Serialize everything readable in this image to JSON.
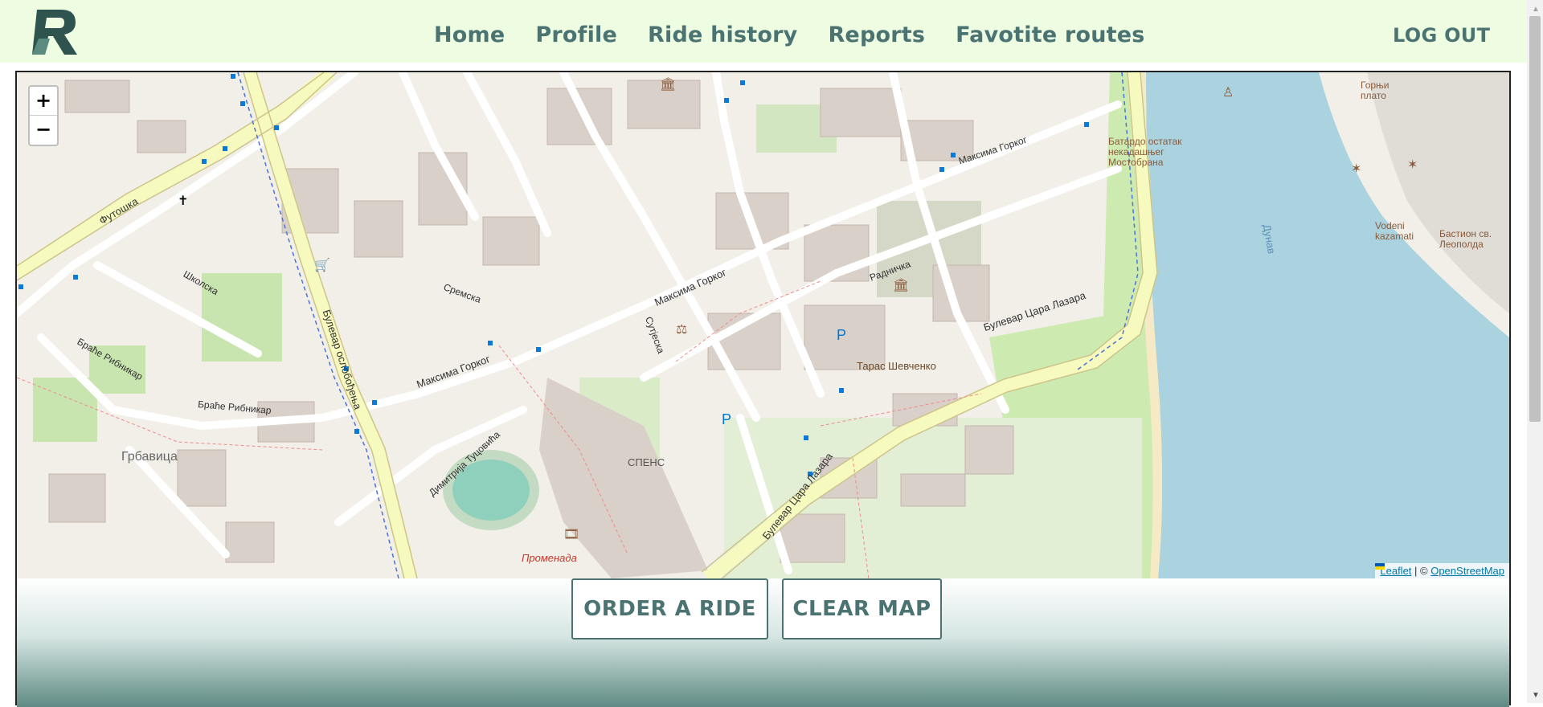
{
  "header": {
    "logo_alt": "R",
    "nav": [
      {
        "label": "Home"
      },
      {
        "label": "Profile"
      },
      {
        "label": "Ride history"
      },
      {
        "label": "Reports"
      },
      {
        "label": "Favotite routes"
      }
    ],
    "logout_label": "LOG OUT"
  },
  "map": {
    "zoom_in": "+",
    "zoom_out": "−",
    "attribution": {
      "leaflet": "Leaflet",
      "separator": " | © ",
      "osm": "OpenStreetMap"
    },
    "labels": {
      "futoshka": "Футошка",
      "skolska": "Школска",
      "bulevar_oslobodjenja": "Булевар ослобођења",
      "maksima_gorkog": "Максима Горког",
      "maksima_gorkog_2": "Максима Горког",
      "maksima_gorkog_3": "Максима Горког",
      "bulevar_cara_lazara": "Булевар Цара Лазара",
      "bulevar_cara_lazara_2": "Булевар Цара Лазара",
      "grbavica": "Грбавица",
      "spens": "СПЕНС",
      "promenada": "Променада",
      "taras": "Тарас Шевченко",
      "dunav": "Дунав",
      "batardo": "Батардо остатак некадашњег Мостобрана",
      "vodeni": "Vodeni kazamati",
      "bastion": "Бастион св. Леополда",
      "gornji_plato": "Горњи плато",
      "sremska": "Сремска",
      "radnichka": "Радничка",
      "brace_ribnikar": "Браће Рибникар",
      "brace_ribnikar_2": "Браће Рибникар",
      "sutjeska": "Сутјеска",
      "dimitrija": "Димитрија Туцовића",
      "p1": "P",
      "p2": "P"
    }
  },
  "actions": {
    "order_label": "ORDER A RIDE",
    "clear_label": "CLEAR MAP"
  },
  "colors": {
    "accent": "#4a7372",
    "header_bg": "#eefce2",
    "water": "#aad3df",
    "boulevard": "#f7fabf"
  }
}
